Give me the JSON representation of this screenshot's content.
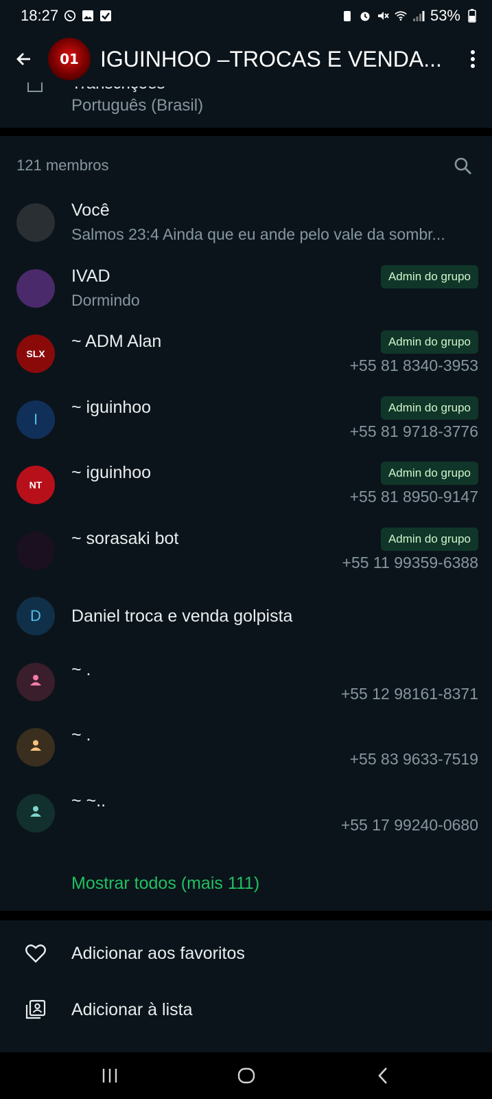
{
  "status_bar": {
    "time": "18:27",
    "battery": "53%"
  },
  "app_bar": {
    "title": "IGUINHOO ‒TROCAS E VENDA...",
    "avatar_text": "01"
  },
  "language": {
    "partial_label": "Transcrições",
    "value": "Português (Brasil)"
  },
  "members": {
    "header": "121 membros",
    "items": [
      {
        "name": "Você",
        "sub": "Salmos 23:4 Ainda que eu ande pelo vale da sombr...",
        "phone": "",
        "badge": "",
        "avatar_letter": "",
        "avatar_color": "#2a2f33"
      },
      {
        "name": "IVAD",
        "sub": "Dormindo",
        "phone": "",
        "badge": "Admin do grupo",
        "avatar_letter": "",
        "avatar_color": "#4b2a6b"
      },
      {
        "name": "~ ADM Alan",
        "sub": "",
        "phone": "+55 81 8340-3953",
        "badge": "Admin do grupo",
        "avatar_letter": "SLX",
        "avatar_color": "#8a0a0a"
      },
      {
        "name": "~ iguinhoo",
        "sub": "",
        "phone": "+55 81 9718-3776",
        "badge": "Admin do grupo",
        "avatar_letter": "I",
        "avatar_color": "#10305a"
      },
      {
        "name": "~ iguinhoo",
        "sub": "",
        "phone": "+55 81 8950-9147",
        "badge": "Admin do grupo",
        "avatar_letter": "NT",
        "avatar_color": "#b8101a"
      },
      {
        "name": "~ sorasaki bot",
        "sub": "",
        "phone": "+55 11 99359-6388",
        "badge": "Admin do grupo",
        "avatar_letter": "",
        "avatar_color": "#1a1020"
      },
      {
        "name": "Daniel troca e venda golpista",
        "sub": "",
        "phone": "",
        "badge": "",
        "avatar_letter": "D",
        "avatar_color": "#10304a"
      },
      {
        "name": "~ .",
        "sub": "",
        "phone": "+55 12 98161-8371",
        "badge": "",
        "avatar_letter": "",
        "avatar_color": "#3a1e2c"
      },
      {
        "name": "~ .",
        "sub": "",
        "phone": "+55 83 9633-7519",
        "badge": "",
        "avatar_letter": "",
        "avatar_color": "#3a2e1e"
      },
      {
        "name": "~ ~..",
        "sub": "",
        "phone": "+55 17 99240-0680",
        "badge": "",
        "avatar_letter": "",
        "avatar_color": "#12302e"
      }
    ],
    "show_all": "Mostrar todos (mais 111)"
  },
  "actions": {
    "favorites": "Adicionar aos favoritos",
    "add_list": "Adicionar à lista"
  },
  "colors": {
    "background": "#0b141a",
    "accent_green": "#21c063",
    "badge_bg": "#103629",
    "secondary_text": "#8696a0"
  }
}
